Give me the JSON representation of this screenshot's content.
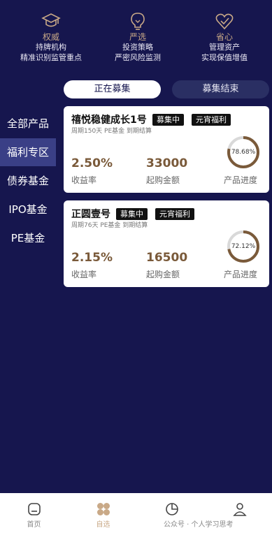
{
  "features": [
    {
      "icon": "graduation-cap-icon",
      "title": "权威",
      "line1": "持牌机构",
      "line2": "精准识别监管重点"
    },
    {
      "icon": "lightbulb-icon",
      "title": "严选",
      "line1": "投资策略",
      "line2": "严密风险监测"
    },
    {
      "icon": "heart-check-icon",
      "title": "省心",
      "line1": "管理资产",
      "line2": "实现保值增值"
    }
  ],
  "tabs": {
    "active": "正在募集",
    "inactive": "募集结束"
  },
  "sidebar": {
    "items": [
      {
        "label": "全部产品"
      },
      {
        "label": "福利专区"
      },
      {
        "label": "债券基金"
      },
      {
        "label": "IPO基金"
      },
      {
        "label": "PE基金"
      }
    ],
    "selected_index": 1
  },
  "products": [
    {
      "name": "禧悦稳健成长1号",
      "badges": [
        "募集中",
        "元宵福利"
      ],
      "subtitle": "周期150天 PE基金 到期结算",
      "rate": "2.50%",
      "rate_label": "收益率",
      "amount": "33000",
      "amount_label": "起购金额",
      "progress_text": "78.68%",
      "progress": 0.7868,
      "progress_label": "产品进度"
    },
    {
      "name": "正圆壹号",
      "badges": [
        "募集中",
        "元宵福利"
      ],
      "subtitle": "周期76天 PE基金 到期结算",
      "rate": "2.15%",
      "rate_label": "收益率",
      "amount": "16500",
      "amount_label": "起购金额",
      "progress_text": "72.12%",
      "progress": 0.7212,
      "progress_label": "产品进度"
    }
  ],
  "bottom_nav": [
    {
      "label": "首页",
      "icon": "home-icon"
    },
    {
      "label": "自选",
      "icon": "favorites-icon"
    },
    {
      "label": "",
      "icon": "pie-chart-icon"
    },
    {
      "label": "",
      "icon": "profile-icon"
    }
  ],
  "watermark": "公众号 · 个人学习思考",
  "colors": {
    "background": "#16164e",
    "accent": "#c9a987",
    "value": "#7a5a3a",
    "selected": "#3a3f86"
  }
}
